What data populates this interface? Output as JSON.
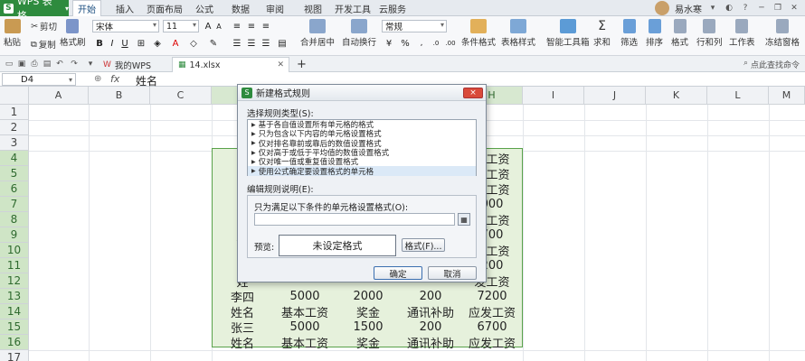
{
  "app": {
    "menu_label": "WPS 表格",
    "logo_letter": "S"
  },
  "ribbon_tabs": [
    "开始",
    "插入",
    "页面布局",
    "公式",
    "数据",
    "审阅",
    "视图",
    "开发工具",
    "云服务"
  ],
  "user": {
    "name": "易水寒"
  },
  "ribbon": {
    "paste": "粘贴",
    "cut": "剪切",
    "copy": "复制",
    "format_painter": "格式刷",
    "font_name": "宋体",
    "font_size": "11",
    "merge_center": "合并居中",
    "wrap_text": "自动换行",
    "number_format": "常规",
    "conditional_format": "条件格式",
    "table_style": "表格样式",
    "smart_toolbox": "智能工具箱",
    "sum": "求和",
    "filter": "筛选",
    "sort": "排序",
    "format": "格式",
    "row_col": "行和列",
    "worksheet": "工作表",
    "freeze": "冻结窗格"
  },
  "doc_tabs": {
    "home": "我的WPS",
    "file": "14.xlsx"
  },
  "help_hint": "点此查找命令",
  "formula_bar": {
    "cell_ref": "D4",
    "fx": "fx",
    "value": "姓名"
  },
  "columns": [
    "A",
    "B",
    "C",
    "D",
    "E",
    "F",
    "G",
    "H",
    "I",
    "J",
    "K",
    "L",
    "M"
  ],
  "rows": [
    "1",
    "2",
    "3",
    "4",
    "5",
    "6",
    "7",
    "8",
    "9",
    "10",
    "11",
    "12",
    "13",
    "14",
    "15",
    "16",
    "17"
  ],
  "visible_cells": {
    "r4": [
      "姓",
      "",
      "",
      "",
      "发工资"
    ],
    "r5": [
      "黄",
      "",
      "",
      "",
      "发工资"
    ],
    "r6": [
      "姓",
      "",
      "",
      "",
      "发工资"
    ],
    "r7": [
      "周",
      "",
      "",
      "",
      "000"
    ],
    "r8": [
      "姓",
      "",
      "",
      "",
      "发工资"
    ],
    "r9": [
      "赵",
      "",
      "",
      "",
      "700"
    ],
    "r10": [
      "姓",
      "",
      "",
      "",
      "发工资"
    ],
    "r11": [
      "王",
      "",
      "",
      "",
      "200"
    ],
    "r12": [
      "姓",
      "",
      "",
      "",
      "发工资"
    ],
    "r13": [
      "李四",
      "5000",
      "2000",
      "200",
      "7200"
    ],
    "r14": [
      "姓名",
      "基本工资",
      "奖金",
      "通讯补助",
      "应发工资"
    ],
    "r15": [
      "张三",
      "5000",
      "1500",
      "200",
      "6700"
    ],
    "r16": [
      "姓名",
      "基本工资",
      "奖金",
      "通讯补助",
      "应发工资"
    ]
  },
  "dialog": {
    "title": "新建格式规则",
    "close": "×",
    "rule_type_label": "选择规则类型(S):",
    "rule_types": [
      "基于各自值设置所有单元格的格式",
      "只为包含以下内容的单元格设置格式",
      "仅对排名靠前或靠后的数值设置格式",
      "仅对高于或低于平均值的数值设置格式",
      "仅对唯一值或重复值设置格式",
      "使用公式确定要设置格式的单元格"
    ],
    "selected_rule_index": 5,
    "desc_label": "编辑规则说明(E):",
    "formula_label": "只为满足以下条件的单元格设置格式(O):",
    "formula_value": "",
    "preview_label": "预览:",
    "preview_text": "未设定格式",
    "format_button": "格式(F)...",
    "ok_button": "确定",
    "cancel_button": "取消"
  },
  "colors": {
    "accent_green": "#2e8b3e",
    "table_fill": "#e6f1dc",
    "table_border": "#59a24a",
    "close_red": "#d94a3a"
  }
}
